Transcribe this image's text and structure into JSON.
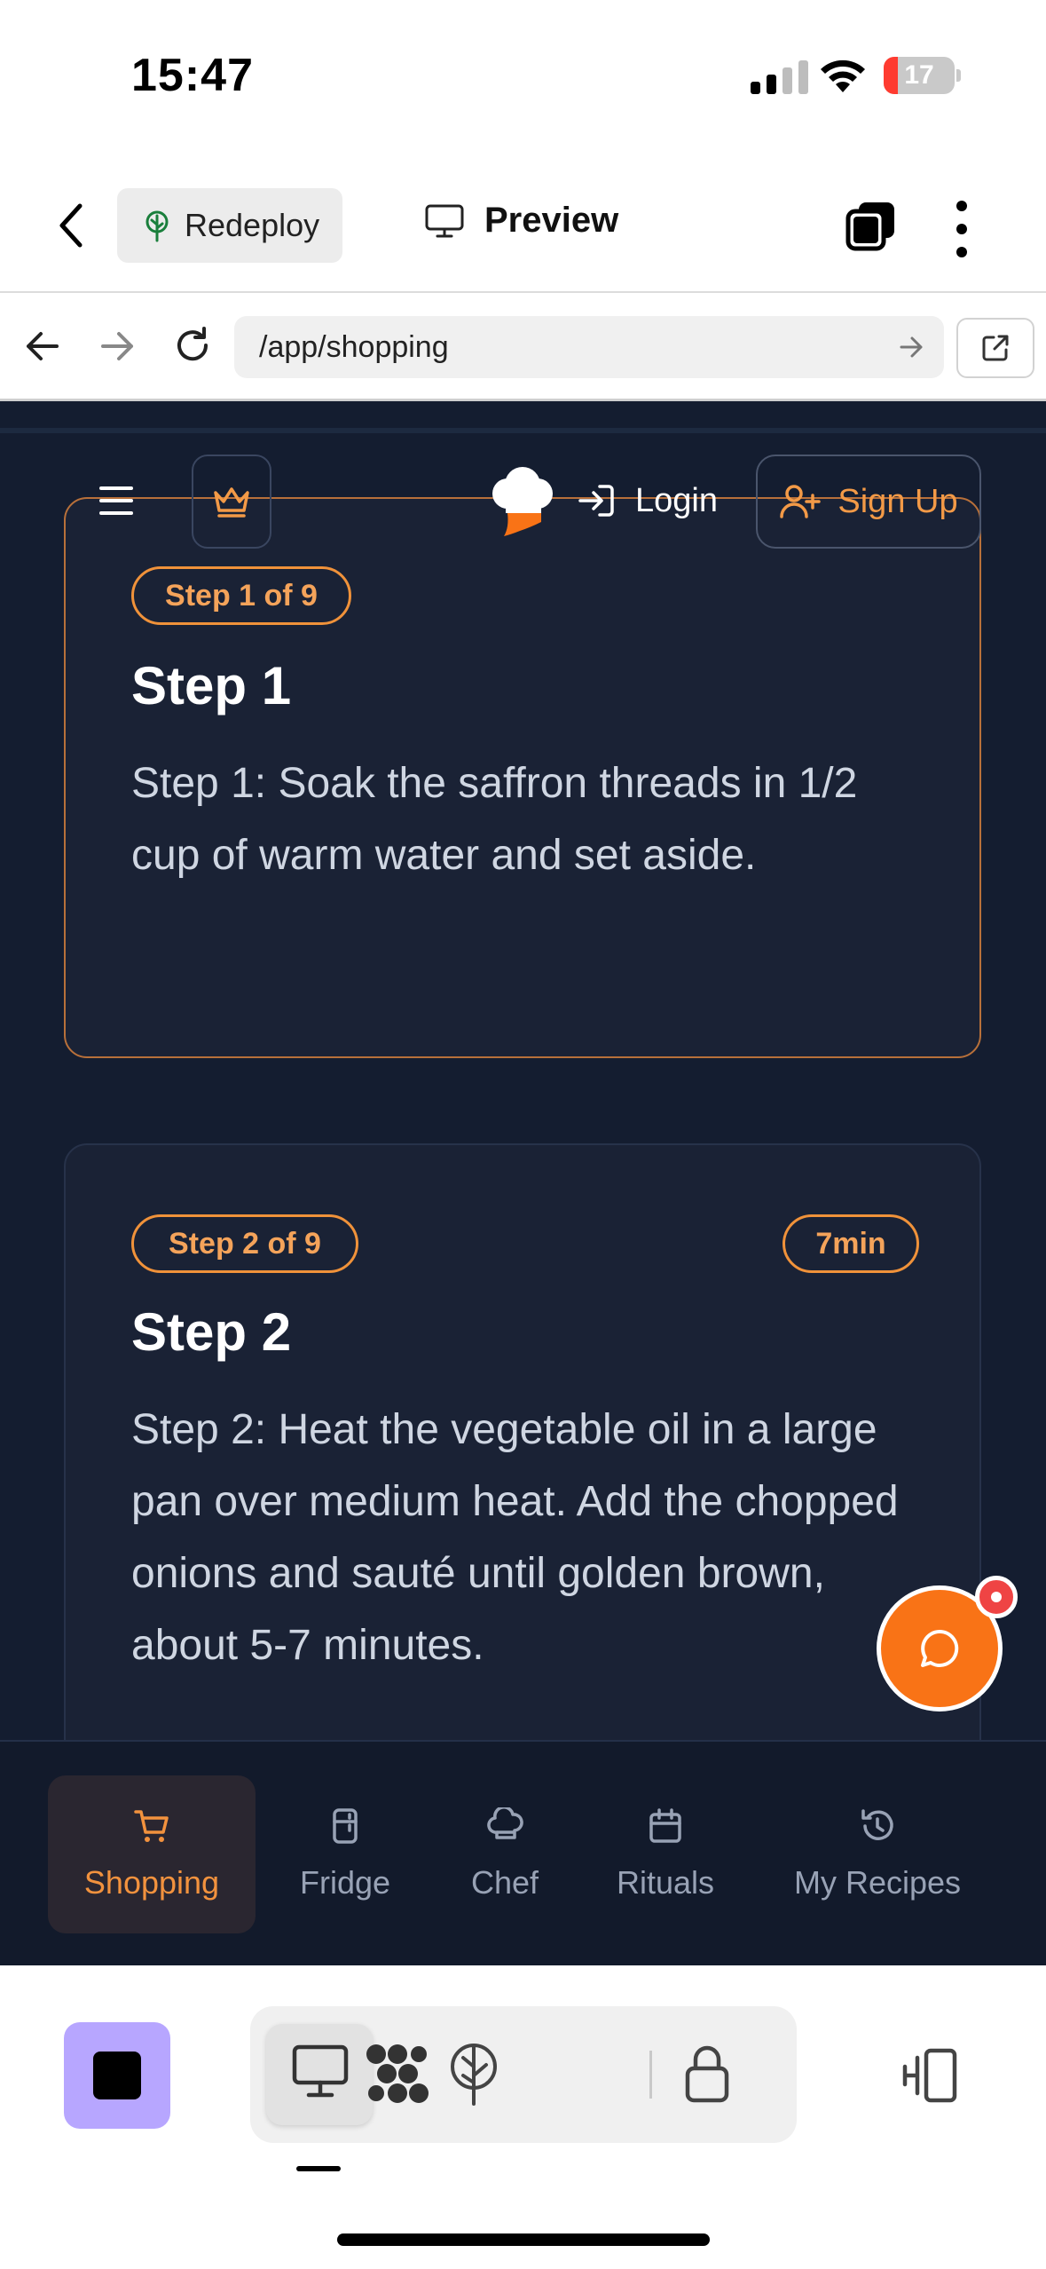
{
  "status_bar": {
    "time": "15:47",
    "battery": "17"
  },
  "editor": {
    "redeploy_label": "Redeploy",
    "preview_label": "Preview"
  },
  "browser": {
    "url": "/app/shopping"
  },
  "header": {
    "login_label": "Login",
    "signup_label": "Sign Up"
  },
  "steps": [
    {
      "badge": "Step 1 of 9",
      "title": "Step 1",
      "body": "Step 1: Soak the saffron threads in 1/2 cup of warm water and set aside."
    },
    {
      "badge": "Step 2 of 9",
      "time_badge": "7min",
      "title": "Step 2",
      "body": "Step 2: Heat the vegetable oil in a large pan over medium heat. Add the chopped onions and sauté until golden brown, about 5-7 minutes."
    }
  ],
  "tabs": [
    {
      "label": "Shopping",
      "icon": "cart-icon",
      "active": true
    },
    {
      "label": "Fridge",
      "icon": "fridge-icon"
    },
    {
      "label": "Chef",
      "icon": "chef-hat-icon"
    },
    {
      "label": "Rituals",
      "icon": "calendar-icon"
    },
    {
      "label": "My Recipes",
      "icon": "history-icon"
    }
  ],
  "colors": {
    "accent": "#f97316",
    "app_background": "#141d30",
    "card_background": "#1a2235"
  }
}
